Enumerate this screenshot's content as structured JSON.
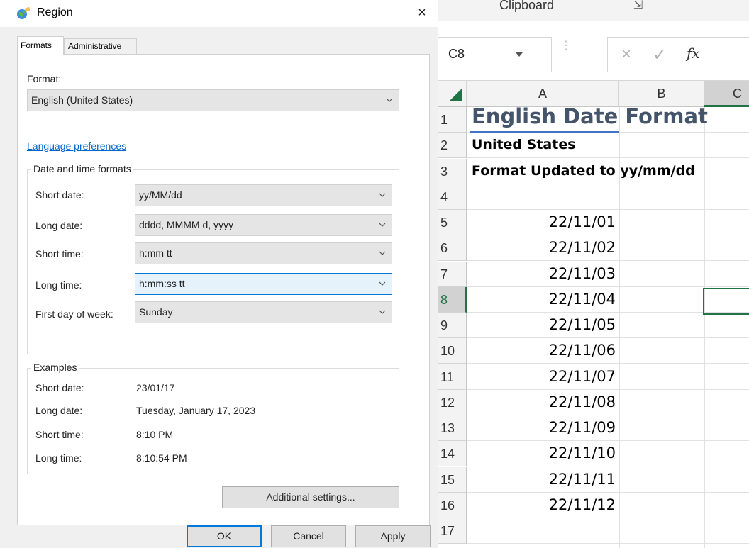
{
  "dialog": {
    "title": "Region",
    "close_glyph": "×",
    "tabs": [
      "Formats",
      "Administrative"
    ],
    "format_label": "Format:",
    "format_value": "English (United States)",
    "language_link": "Language preferences",
    "date_time_group": "Date and time formats",
    "fields": [
      {
        "label": "Short date:",
        "value": "yy/MM/dd"
      },
      {
        "label": "Long date:",
        "value": "dddd, MMMM d, yyyy"
      },
      {
        "label": "Short time:",
        "value": "h:mm tt"
      },
      {
        "label": "Long time:",
        "value": "h:mm:ss tt"
      },
      {
        "label": "First day of week:",
        "value": "Sunday"
      }
    ],
    "examples_group": "Examples",
    "examples": [
      {
        "label": "Short date:",
        "value": "23/01/17"
      },
      {
        "label": "Long date:",
        "value": "Tuesday, January 17, 2023"
      },
      {
        "label": "Short time:",
        "value": "8:10 PM"
      },
      {
        "label": "Long time:",
        "value": "8:10:54 PM"
      }
    ],
    "additional_settings": "Additional settings...",
    "buttons": {
      "ok": "OK",
      "cancel": "Cancel",
      "apply": "Apply"
    }
  },
  "excel": {
    "ribbon_group": "Clipboard",
    "ribbon_launcher": "⇲",
    "name_box": "C8",
    "formula_cancel": "×",
    "formula_enter": "✓",
    "formula_fx": "fx",
    "columns": [
      "A",
      "B",
      "C"
    ],
    "rows": [
      {
        "num": "1",
        "a": "English Date Format"
      },
      {
        "num": "2",
        "a": "United States"
      },
      {
        "num": "3",
        "a": "Format Updated to yy/mm/dd"
      },
      {
        "num": "4",
        "a": ""
      },
      {
        "num": "5",
        "a": "22/11/01"
      },
      {
        "num": "6",
        "a": "22/11/02"
      },
      {
        "num": "7",
        "a": "22/11/03"
      },
      {
        "num": "8",
        "a": "22/11/04"
      },
      {
        "num": "9",
        "a": "22/11/05"
      },
      {
        "num": "10",
        "a": "22/11/06"
      },
      {
        "num": "11",
        "a": "22/11/07"
      },
      {
        "num": "12",
        "a": "22/11/08"
      },
      {
        "num": "13",
        "a": "22/11/09"
      },
      {
        "num": "14",
        "a": "22/11/10"
      },
      {
        "num": "15",
        "a": "22/11/11"
      },
      {
        "num": "16",
        "a": "22/11/12"
      },
      {
        "num": "17",
        "a": ""
      }
    ],
    "colors": {
      "title_text": "#44546a",
      "title_underline": "#4472c4",
      "selection": "#217346"
    }
  }
}
